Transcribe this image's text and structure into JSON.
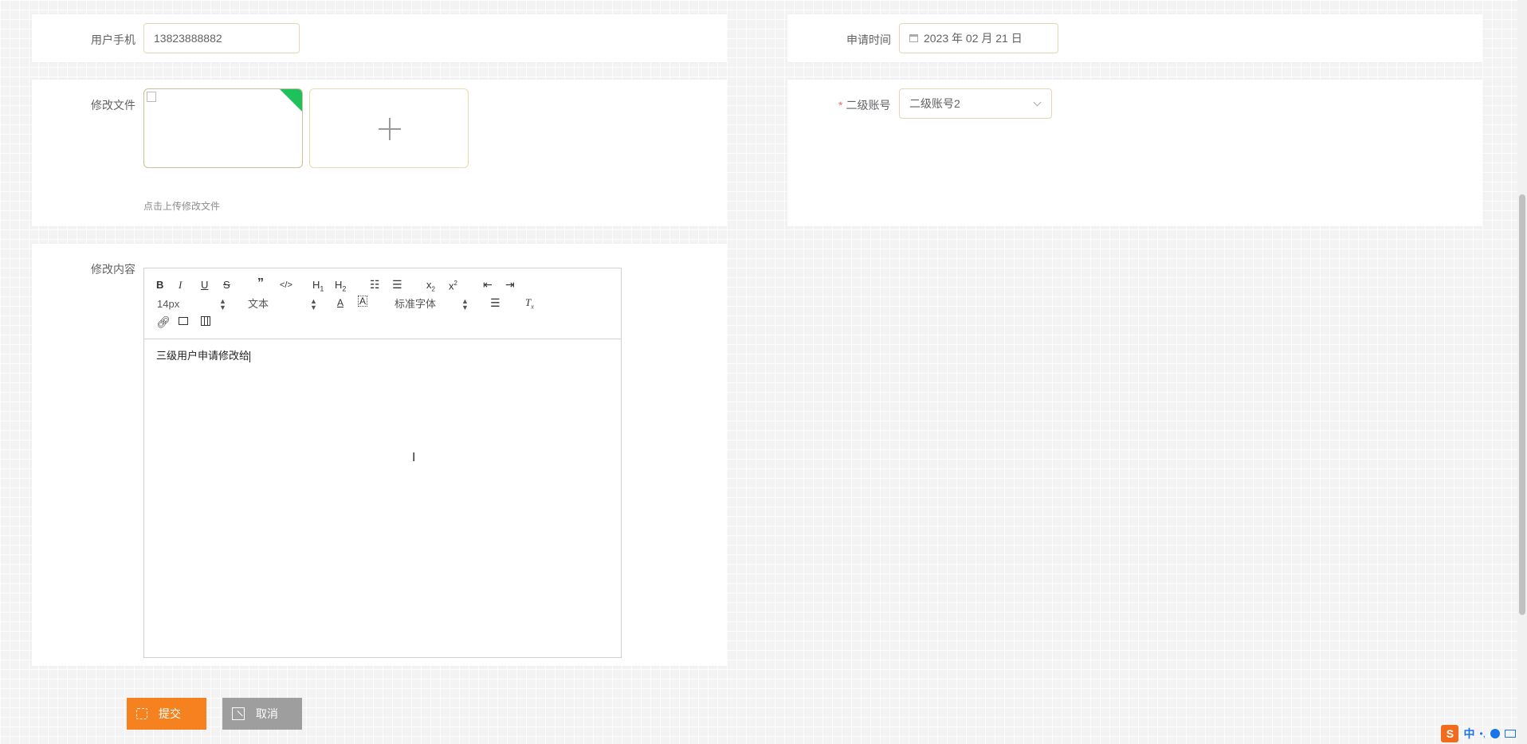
{
  "form": {
    "phone_label": "用户手机",
    "phone_value": "13823888882",
    "apply_time_label": "申请时间",
    "apply_time_value": "2023 年 02 月 21 日",
    "file_label": "修改文件",
    "file_hint": "点击上传修改文件",
    "sub_account_label": "二级账号",
    "sub_account_required_mark": "*",
    "sub_account_value": "二级账号2",
    "content_label": "修改内容"
  },
  "editor": {
    "font_size": "14px",
    "block_format": "文本",
    "font_family": "标准字体",
    "content": "三级用户申请修改给",
    "toolbar_row1": [
      {
        "name": "bold-button",
        "label": "B"
      },
      {
        "name": "italic-button",
        "label": "I"
      },
      {
        "name": "underline-button",
        "label": "U"
      },
      {
        "name": "strike-button",
        "label": "S"
      },
      {
        "name": "blockquote-button",
        "label": "❞"
      },
      {
        "name": "code-button",
        "label": "</>"
      },
      {
        "name": "h1-button",
        "label": "H1"
      },
      {
        "name": "h2-button",
        "label": "H2"
      },
      {
        "name": "ordered-list-button",
        "label": "☰"
      },
      {
        "name": "bullet-list-button",
        "label": "☰"
      },
      {
        "name": "subscript-button",
        "label": "x₂"
      },
      {
        "name": "superscript-button",
        "label": "x²"
      },
      {
        "name": "outdent-button",
        "label": "⇤"
      },
      {
        "name": "indent-button",
        "label": "⇥"
      }
    ]
  },
  "actions": {
    "submit_label": "提交",
    "cancel_label": "取消"
  },
  "colors": {
    "accent": "#f5821f",
    "cancel": "#9e9e9e",
    "upload_ok": "#1dc25b",
    "required": "#f56c6c"
  },
  "taskbar": {
    "ime_logo": "S",
    "ime_mode": "中",
    "ime_punct": "•,"
  }
}
